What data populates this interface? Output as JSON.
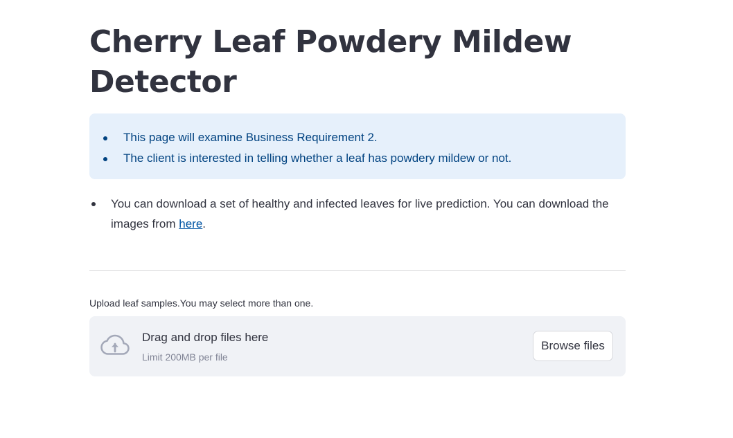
{
  "page": {
    "title": "Cherry Leaf Powdery Mildew Detector"
  },
  "info_box": {
    "items": [
      "This page will examine Business Requirement 2.",
      "The client is interested in telling whether a leaf has powdery mildew or not."
    ]
  },
  "download_note": {
    "text_before": "You can download a set of healthy and infected leaves for live prediction. You can download the images from ",
    "link_text": "here",
    "text_after": "."
  },
  "uploader": {
    "label": "Upload leaf samples.You may select more than one.",
    "drop_title": "Drag and drop files here",
    "limit": "Limit 200MB per file",
    "browse_label": "Browse files",
    "icon": "cloud-upload-icon"
  },
  "colors": {
    "info_bg": "#e6f0fb",
    "info_text": "#004280",
    "link": "#0054a3",
    "dropzone_bg": "#f0f2f6",
    "icon": "#a3a8b8"
  }
}
